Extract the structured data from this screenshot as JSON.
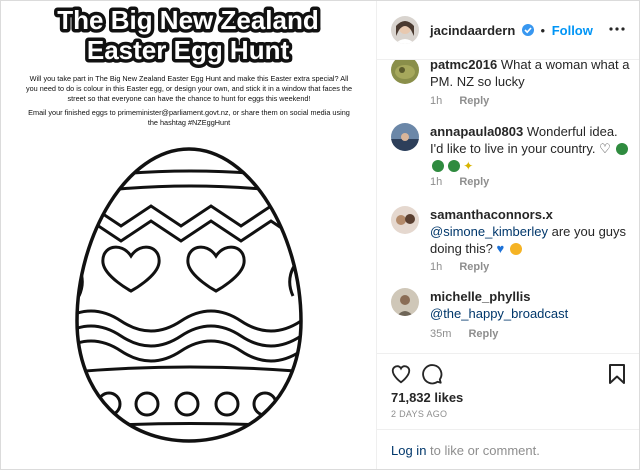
{
  "post": {
    "headline_line1": "The Big New Zealand",
    "headline_line2": "Easter Egg Hunt",
    "paragraph1": "Will you take part in The Big New Zealand Easter Egg Hunt and make this Easter extra special? All you need to do is colour in this Easter egg, or design your own, and stick it in a window that faces the street so that everyone can have the chance to hunt for eggs this weekend!",
    "paragraph2": "Email your finished eggs to primeminister@parliament.govt.nz, or share them on social media using the hashtag #NZEggHunt"
  },
  "header": {
    "username": "jacindaardern",
    "verified_icon": "verified-badge-icon",
    "dot": "•",
    "follow_label": "Follow",
    "more_icon": "more-options-icon"
  },
  "comments": [
    {
      "username": "patmc2016",
      "text": "What a woman what a PM. NZ so lucky",
      "time": "1h",
      "reply": "Reply"
    },
    {
      "username": "annapaula0803",
      "text": "Wonderful idea. I'd like to live in your country.",
      "time": "1h",
      "reply": "Reply"
    },
    {
      "username": "samanthaconnors.x",
      "mention": "@simone_kimberley",
      "text": "are you guys doing this?",
      "time": "1h",
      "reply": "Reply"
    },
    {
      "username": "michelle_phyllis",
      "mention": "@the_happy_broadcast",
      "time": "35m",
      "reply": "Reply"
    }
  ],
  "actions": {
    "like_icon": "heart-icon",
    "comment_icon": "comment-bubble-icon",
    "save_icon": "bookmark-icon",
    "likes": "71,832 likes",
    "date": "2 DAYS AGO"
  },
  "footer": {
    "login_link": "Log in",
    "login_rest": "to like or comment."
  },
  "colors": {
    "follow_blue": "#0095f6",
    "verified_blue": "#3897f0",
    "link_blue": "#00376b"
  }
}
